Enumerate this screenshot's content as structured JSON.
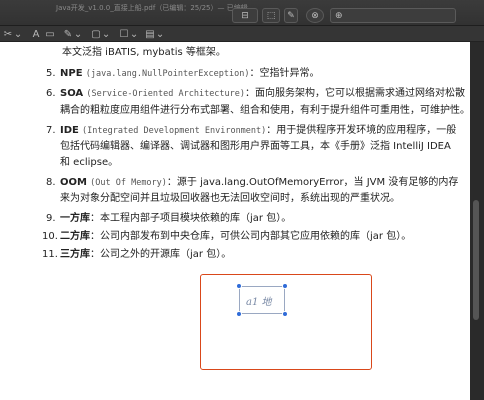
{
  "window": {
    "title": "Java开发_v1.0.0_直接上船.pdf（已编辑：25/25）— 已编辑",
    "buttons": [
      "⊟",
      "⬚",
      "✎",
      "⊗",
      "⊕"
    ]
  },
  "toolbar": {
    "tools": [
      "✂",
      "⌄",
      "A",
      "▭",
      "✎",
      "⌄",
      "▢",
      "⌄",
      "☐",
      "⌄",
      "▤",
      "⌄"
    ]
  },
  "content": {
    "intro_line": "本文泛指 iBATIS, mybatis 等框架。",
    "items": [
      {
        "num": "5.",
        "term": "NPE",
        "full": "(java.lang.NullPointerException)",
        "desc": "：空指针异常。",
        "cont": []
      },
      {
        "num": "6.",
        "term": "SOA",
        "full": "(Service-Oriented Architecture)",
        "desc": "：面向服务架构，它可以根据需求通过网络对松散",
        "cont": [
          "耦合的粗粒度应用组件进行分布式部署、组合和使用，有利于提升组件可重用性，可维护性。"
        ]
      },
      {
        "num": "7.",
        "term": "IDE",
        "full": "(Integrated Development Environment)",
        "desc": "：用于提供程序开发环境的应用程序，一般",
        "cont": [
          "包括代码编辑器、编译器、调试器和图形用户界面等工具，本《手册》泛指 IntelliJ IDEA",
          "和 eclipse。"
        ]
      },
      {
        "num": "8.",
        "term": "OOM",
        "full": "(Out Of Memory)",
        "desc": "：源于 java.lang.OutOfMemoryError，当 JVM 没有足够的内存",
        "cont": [
          "来为对象分配空间并且垃圾回收器也无法回收空间时，系统出现的严重状况。"
        ]
      },
      {
        "num": "9.",
        "term": "一方库",
        "full": "",
        "desc": "：本工程内部子项目模块依赖的库（jar 包）。",
        "cont": []
      },
      {
        "num": "10.",
        "term": "二方库",
        "full": "",
        "desc": "：公司内部发布到中央仓库，可供公司内部其它应用依赖的库（jar 包）。",
        "cont": []
      },
      {
        "num": "11.",
        "term": "三方库",
        "full": "",
        "desc": "：公司之外的开源库（jar 包）。",
        "cont": []
      }
    ]
  },
  "annotation": {
    "handwriting": "a1 地",
    "box_color": "#d9471a",
    "handle_color": "#2f6bd8"
  }
}
